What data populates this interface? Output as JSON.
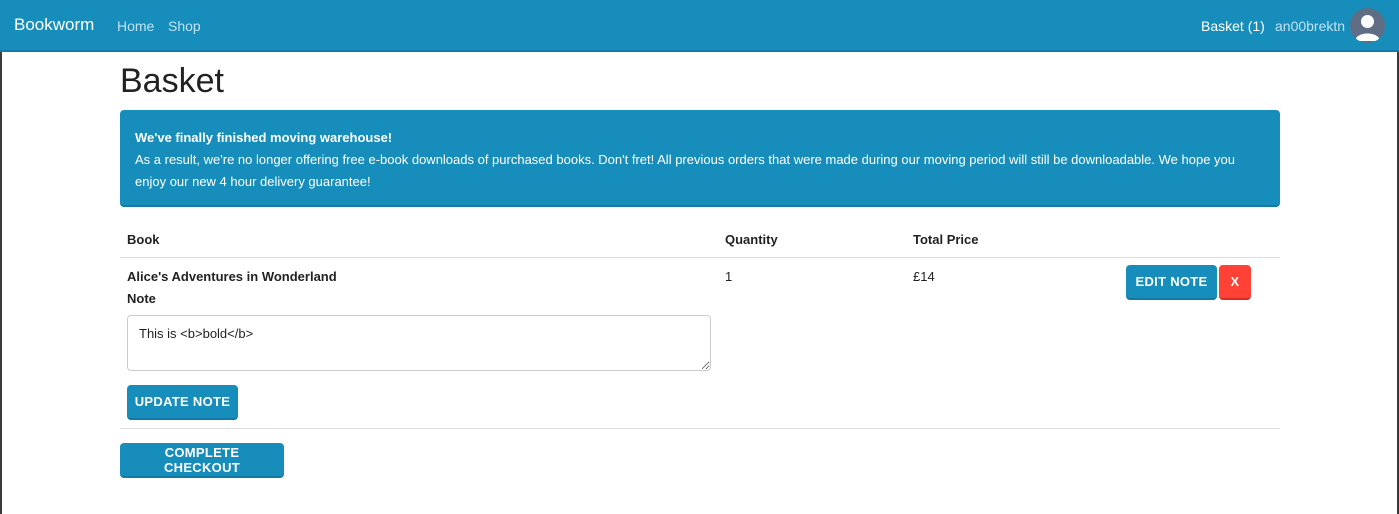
{
  "navbar": {
    "brand": "Bookworm",
    "links": [
      "Home",
      "Shop"
    ],
    "basket": "Basket (1)",
    "username": "an00brektn",
    "avatar_icon": "user-avatar-icon"
  },
  "page": {
    "title": "Basket"
  },
  "alert": {
    "title": "We've finally finished moving warehouse!",
    "body": "As a result, we're no longer offering free e-book downloads of purchased books. Don't fret! All previous orders that were made during our moving period will still be downloadable. We hope you enjoy our new 4 hour delivery guarantee!"
  },
  "table": {
    "headers": [
      "Book",
      "Quantity",
      "Total Price"
    ],
    "rows": [
      {
        "book": "Alice's Adventures in Wonderland",
        "note_label": "Note",
        "note_value": "This is <b>bold</b>",
        "quantity": "1",
        "total_price": "£14",
        "edit_label": "EDIT NOTE",
        "remove_label": "X",
        "update_label": "UPDATE NOTE"
      }
    ]
  },
  "checkout_label": "COMPLETE CHECKOUT",
  "colors": {
    "primary": "#178dbb",
    "danger": "#ff4136"
  }
}
